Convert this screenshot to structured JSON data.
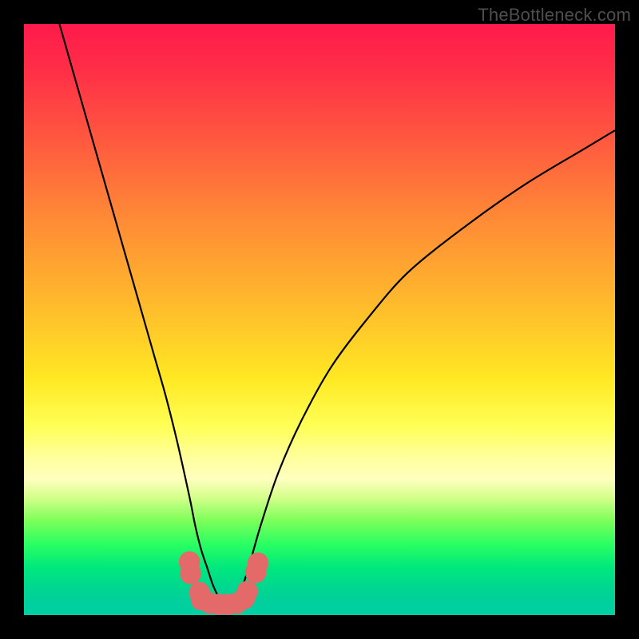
{
  "watermark": "TheBottleneck.com",
  "chart_data": {
    "type": "line",
    "title": "",
    "xlabel": "",
    "ylabel": "",
    "xlim": [
      0,
      100
    ],
    "ylim": [
      0,
      100
    ],
    "series": [
      {
        "name": "curve",
        "x": [
          6,
          8,
          10,
          12,
          14,
          16,
          18,
          20,
          22,
          24,
          26,
          28,
          29,
          30,
          31,
          32,
          33,
          34,
          35,
          36,
          37,
          38,
          40,
          43,
          47,
          52,
          58,
          65,
          75,
          85,
          95,
          100
        ],
        "y": [
          100,
          93,
          86,
          79,
          72,
          65,
          58,
          51,
          44,
          37,
          29,
          20,
          15,
          11,
          8,
          5,
          3,
          2,
          2,
          3,
          5,
          8,
          15,
          24,
          33,
          42,
          50,
          58,
          66,
          73,
          79,
          82
        ]
      }
    ],
    "markers": [
      {
        "x": 28.0,
        "y": 9.0,
        "r": 1.5
      },
      {
        "x": 28.2,
        "y": 7.0,
        "r": 1.5
      },
      {
        "x": 29.7,
        "y": 3.8,
        "r": 1.5
      },
      {
        "x": 30.0,
        "y": 2.6,
        "r": 1.5
      },
      {
        "x": 31.5,
        "y": 2.0,
        "r": 1.5
      },
      {
        "x": 33.0,
        "y": 1.8,
        "r": 1.5
      },
      {
        "x": 34.5,
        "y": 1.8,
        "r": 1.5
      },
      {
        "x": 36.0,
        "y": 2.0,
        "r": 1.5
      },
      {
        "x": 37.3,
        "y": 2.8,
        "r": 1.5
      },
      {
        "x": 37.8,
        "y": 4.0,
        "r": 1.5
      },
      {
        "x": 39.2,
        "y": 7.2,
        "r": 1.5
      },
      {
        "x": 39.6,
        "y": 8.8,
        "r": 1.5
      }
    ],
    "colors": {
      "curve_stroke": "#000000",
      "marker_fill": "#e46a6a"
    }
  }
}
